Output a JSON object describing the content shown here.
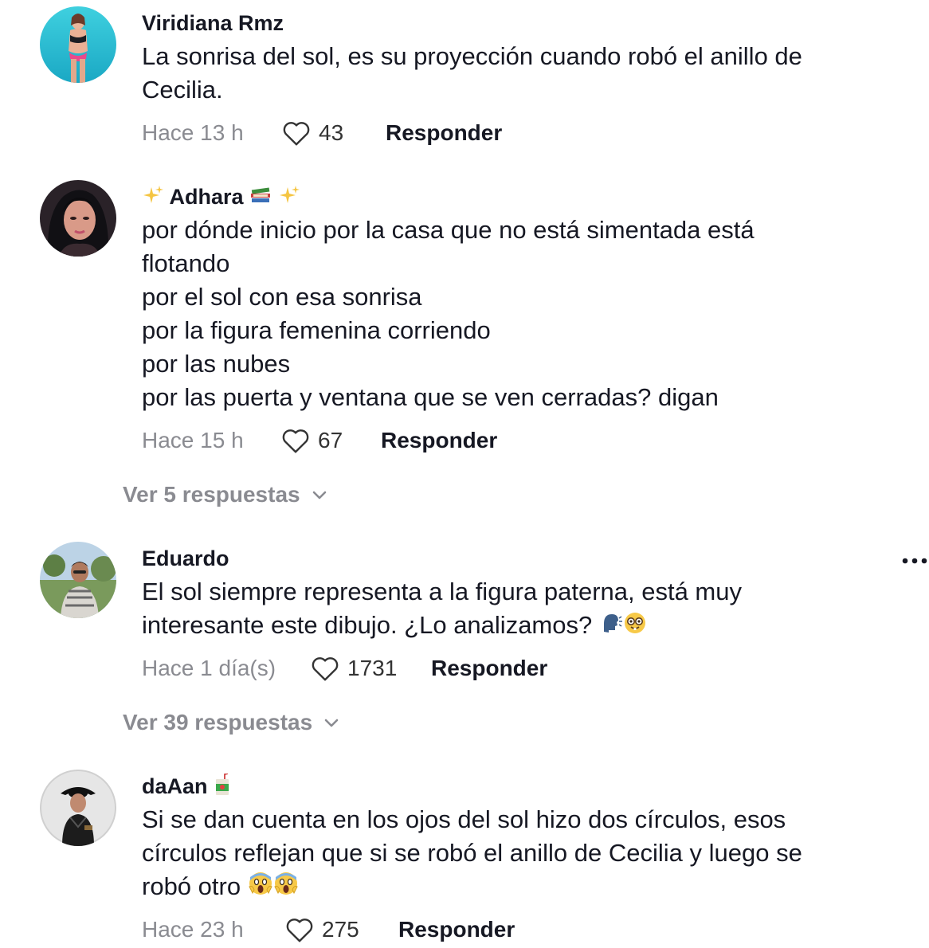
{
  "comments": [
    {
      "username": "Viridiana Rmz",
      "text_lines": [
        "La sonrisa del sol, es su proyección cuando robó el anillo de",
        "Cecilia."
      ],
      "time": "Hace 13 h",
      "likes": "43",
      "reply_label": "Responder"
    },
    {
      "username": "Adhara",
      "text_lines": [
        "por dónde inicio por la casa que no está simentada está",
        "flotando",
        "por el sol con esa sonrisa",
        "por la figura femenina corriendo",
        "por las nubes",
        "por las puerta y ventana que se ven cerradas? digan"
      ],
      "time": "Hace 15 h",
      "likes": "67",
      "reply_label": "Responder",
      "view_replies": "Ver 5 respuestas"
    },
    {
      "username": "Eduardo",
      "text_lines": [
        "El sol siempre representa a la figura paterna, está muy",
        "interesante este dibujo. ¿Lo analizamos?"
      ],
      "time": "Hace 1 día(s)",
      "likes": "1731",
      "reply_label": "Responder",
      "view_replies": "Ver 39 respuestas"
    },
    {
      "username": "daAan",
      "text_lines": [
        "Si se dan cuenta en los ojos del sol hizo dos círculos, esos",
        "círculos reflejan que si se robó el anillo de Cecilia y luego se",
        "robó otro"
      ],
      "time": "Hace 23 h",
      "likes": "275",
      "reply_label": "Responder"
    }
  ],
  "icons": {
    "like": "heart-outline-icon",
    "expand": "chevron-down-icon",
    "more": "more-options-icon"
  },
  "colors": {
    "text": "#161823",
    "muted": "#8a8b91"
  }
}
